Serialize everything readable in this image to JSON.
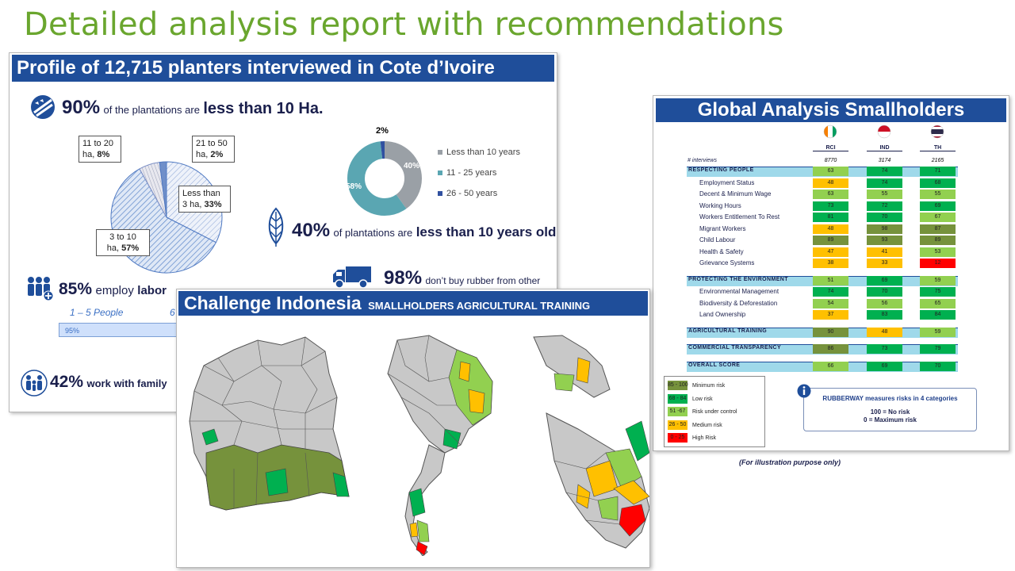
{
  "page_title": "Detailed analysis report with recommendations",
  "profile": {
    "header": "Profile of 12,715 planters interviewed in Cote d’Ivoire",
    "stat1": {
      "value": "90%",
      "text": "of the plantations are",
      "bold": "less than 10 Ha."
    },
    "pie": [
      {
        "label": "Less than 3 ha",
        "value": "33%"
      },
      {
        "label": "3 to 10 ha",
        "value": "57%"
      },
      {
        "label": "11 to 20 ha",
        "value": "8%"
      },
      {
        "label": "21 to 50 ha",
        "value": "2%"
      }
    ],
    "pie_labels": {
      "less3_line1": "Less than",
      "less3_line2": "3 ha, ",
      "less3_val": "33%",
      "t10_line1": "3 to 10",
      "t10_line2": "ha, ",
      "t10_val": "57%",
      "t20_line1": "11 to 20",
      "t20_line2": "ha, ",
      "t20_val": "8%",
      "t50_line1": "21 to 50",
      "t50_line2": "ha, ",
      "t50_val": "2%"
    },
    "donut": {
      "label_top": "2%",
      "label_left": "58%",
      "label_right": "40%",
      "legend": [
        "Less than 10 years",
        "11 - 25 years",
        "26 - 50 years"
      ]
    },
    "stat2": {
      "value": "40%",
      "text": "of plantations are",
      "bold": "less than 10 years old",
      "tail": "."
    },
    "stat3": {
      "value": "98%",
      "text": "don’t buy rubber from other"
    },
    "stat4": {
      "value": "85%",
      "text": "employ",
      "bold": "labor"
    },
    "labor_scale": {
      "left": "1 – 5 People",
      "right": "6",
      "bar_value": "95%"
    },
    "stat5": {
      "value": "42%",
      "text": "work with family"
    }
  },
  "global": {
    "header": "Global Analysis Smallholders",
    "columns": [
      "RCI",
      "IND",
      "TH"
    ],
    "interviews_label": "# interviews",
    "interviews": [
      "8770",
      "3174",
      "2165"
    ],
    "categories": [
      {
        "name": "RESPECTING PEOPLE",
        "values": [
          "63",
          "74",
          "71"
        ],
        "items": [
          {
            "name": "Employment Status",
            "values": [
              "48",
              "74",
              "68"
            ]
          },
          {
            "name": "Decent & Minimum Wage",
            "values": [
              "63",
              "55",
              "55"
            ]
          },
          {
            "name": "Working Hours",
            "values": [
              "73",
              "72",
              "69"
            ]
          },
          {
            "name": "Workers Entitlement To Rest",
            "values": [
              "81",
              "70",
              "67"
            ]
          },
          {
            "name": "Migrant Workers",
            "values": [
              "48",
              "98",
              "87"
            ]
          },
          {
            "name": "Child Labour",
            "values": [
              "89",
              "93",
              "89"
            ]
          },
          {
            "name": "Health & Safety",
            "values": [
              "47",
              "41",
              "53"
            ]
          },
          {
            "name": "Grievance Systems",
            "values": [
              "38",
              "33",
              "12"
            ]
          }
        ]
      },
      {
        "name": "PROTECTING THE ENVIRONMENT",
        "values": [
          "51",
          "69",
          "59"
        ],
        "items": [
          {
            "name": "Environmental Management",
            "values": [
              "74",
              "70",
              "75"
            ]
          },
          {
            "name": "Biodiversity & Deforestation",
            "values": [
              "54",
              "56",
              "65"
            ]
          },
          {
            "name": "Land Ownership",
            "values": [
              "37",
              "83",
              "84"
            ]
          }
        ]
      },
      {
        "name": "AGRICULTURAL TRAINING",
        "values": [
          "90",
          "48",
          "59"
        ],
        "items": []
      },
      {
        "name": "COMMERCIAL TRANSPARENCY",
        "values": [
          "86",
          "73",
          "79"
        ],
        "items": []
      },
      {
        "name": "OVERALL SCORE",
        "values": [
          "66",
          "69",
          "70"
        ],
        "items": []
      }
    ],
    "info": {
      "title": "RUBBERWAY measures risks in 4 categories",
      "line1": "100 = No risk",
      "line2": "0 = Maximum risk"
    },
    "note": "(For illustration  purpose only)"
  },
  "risk_legend": [
    {
      "range": "85 - 100",
      "label": "Minimum risk",
      "color": "#76923c"
    },
    {
      "range": "68 - 84",
      "label": "Low risk",
      "color": "#00b050"
    },
    {
      "range": "51 -67",
      "label": "Risk under control",
      "color": "#92d050"
    },
    {
      "range": "26 - 50",
      "label": "Medium risk",
      "color": "#ffc000"
    },
    {
      "range": "0 - 25",
      "label": "High Risk",
      "color": "#ff0000"
    }
  ],
  "indonesia": {
    "title": "Challenge Indonesia",
    "subtitle": "SMALLHOLDERS AGRICULTURAL TRAINING"
  }
}
